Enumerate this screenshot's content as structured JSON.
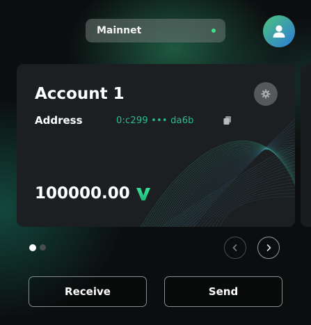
{
  "header": {
    "network_label": "Mainnet",
    "network_status_color": "#3fe08f"
  },
  "account_card": {
    "name": "Account 1",
    "address_label": "Address",
    "address_value": "0:c299 ••• da6b",
    "balance": "100000.00",
    "token_icon": "v-token-icon",
    "address_color": "#27c08a"
  },
  "pagination": {
    "total": 2,
    "active_index": 0
  },
  "actions": {
    "receive_label": "Receive",
    "send_label": "Send"
  },
  "icons": {
    "avatar": "user-icon",
    "settings": "gear-icon",
    "copy": "copy-icon",
    "prev": "chevron-left-icon",
    "next": "chevron-right-icon"
  }
}
